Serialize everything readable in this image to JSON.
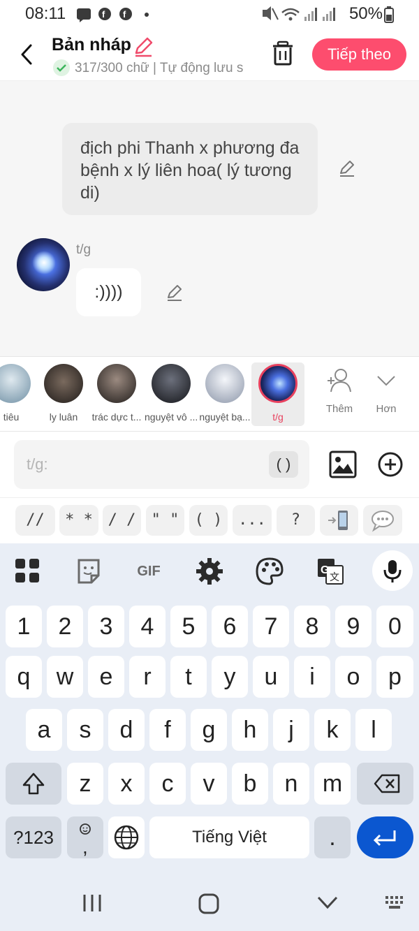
{
  "status_bar": {
    "time": "08:11",
    "battery": "50%"
  },
  "header": {
    "title": "Bản nháp",
    "subtitle": "317/300 chữ | Tự động lưu s",
    "next_label": "Tiếp theo"
  },
  "chat": {
    "narration": "địch phi Thanh x phương đa bệnh x lý liên hoa( lý tương di)",
    "message": {
      "character": "t/g",
      "text": ":))))"
    }
  },
  "characters": [
    {
      "label": "tiêu",
      "color": "#9cb6c9"
    },
    {
      "label": "ly luân",
      "color": "#3a3531"
    },
    {
      "label": "trác dực t...",
      "color": "#403a38"
    },
    {
      "label": "nguyệt vô ...",
      "color": "#2b2d36"
    },
    {
      "label": "nguyệt bạ...",
      "color": "#c9d0db"
    },
    {
      "label": "t/g",
      "color": "#2d4ba8",
      "selected": true
    }
  ],
  "strip_actions": {
    "add_label": "Thêm",
    "more_label": "Hơn"
  },
  "composer": {
    "placeholder": "t/g:",
    "paren_label": "( )"
  },
  "chips": [
    "// //",
    "* *",
    "/ /",
    "\" \"",
    "( )",
    "...",
    "?"
  ],
  "keyboard": {
    "tools": {
      "gif_label": "GIF"
    },
    "rows": [
      [
        "1",
        "2",
        "3",
        "4",
        "5",
        "6",
        "7",
        "8",
        "9",
        "0"
      ],
      [
        "q",
        "w",
        "e",
        "r",
        "t",
        "y",
        "u",
        "i",
        "o",
        "p"
      ],
      [
        "a",
        "s",
        "d",
        "f",
        "g",
        "h",
        "j",
        "k",
        "l"
      ],
      [
        "z",
        "x",
        "c",
        "v",
        "b",
        "n",
        "m"
      ]
    ],
    "symbols_label": "?123",
    "emoji_comma_label": ",",
    "space_label": "Tiếng Việt",
    "period_label": "."
  },
  "colors": {
    "accent": "#fd4d6e",
    "selected_border": "#e8415e",
    "keyboard_bg": "#e9eef6",
    "enter_key": "#0b57d0"
  }
}
